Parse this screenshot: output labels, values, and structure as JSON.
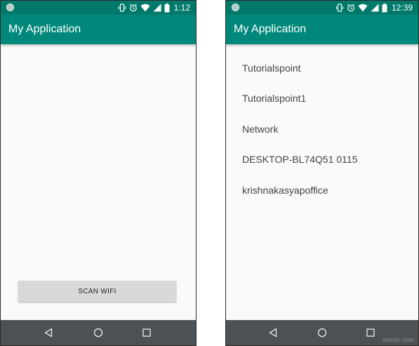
{
  "left_screen": {
    "status_time": "1:12",
    "app_title": "My Application",
    "scan_button_label": "SCAN WIFI"
  },
  "right_screen": {
    "status_time": "12:39",
    "app_title": "My Application",
    "wifi_networks": [
      "Tutorialspoint",
      "Tutorialspoint1",
      "Network",
      "DESKTOP-BL74Q51 0115",
      "krishnakasyapoffice"
    ]
  },
  "watermark": "wsxdn.com",
  "colors": {
    "status_bar": "#00796b",
    "app_bar": "#00897b",
    "nav_bar": "#4c5155",
    "background": "#fafafa",
    "button": "#d8d8d8"
  },
  "icons": {
    "status": [
      "notification-dot-icon",
      "vibrate-icon",
      "alarm-icon",
      "wifi-icon",
      "signal-icon",
      "battery-icon"
    ],
    "nav": [
      "back-icon",
      "home-icon",
      "recents-icon"
    ]
  }
}
